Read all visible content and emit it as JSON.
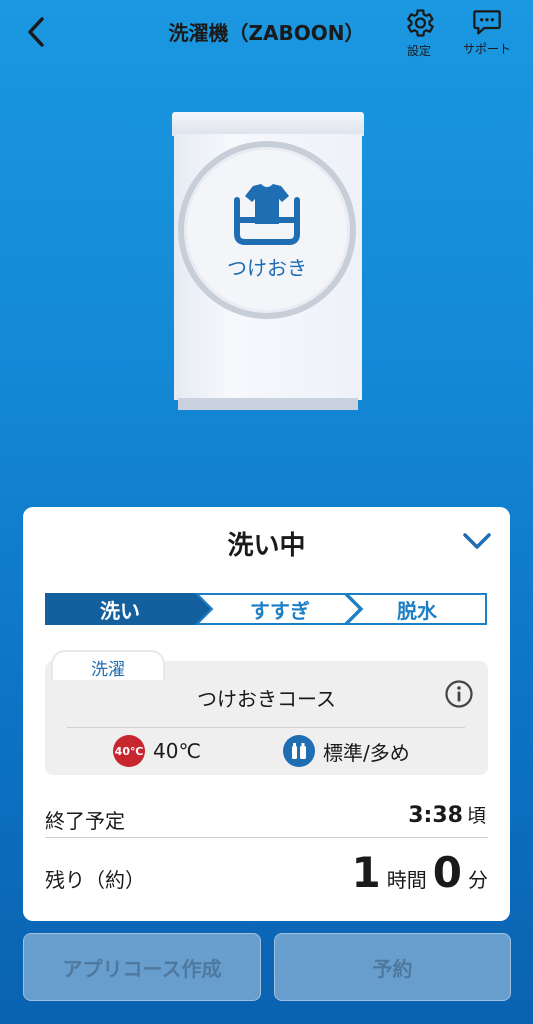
{
  "header": {
    "title": "洗濯機（ZABOON）",
    "settings_label": "設定",
    "support_label": "サポート"
  },
  "washer": {
    "course_label": "つけおき"
  },
  "status": {
    "title": "洗い中",
    "steps": [
      "洗い",
      "すすぎ",
      "脱水"
    ],
    "active_step": "洗い",
    "course_tab": "洗濯",
    "course_name": "つけおきコース",
    "temp_badge": "40℃",
    "temperature": "40℃",
    "detergent": "標準/多め",
    "end_label": "終了予定",
    "end_time": "3:38",
    "end_suffix": "頃",
    "remaining_label": "残り（約）",
    "remaining_hours": "1",
    "hours_unit": "時間",
    "remaining_minutes": "0",
    "minutes_unit": "分"
  },
  "buttons": {
    "create_course": "アプリコース作成",
    "reserve": "予約"
  },
  "colors": {
    "accent": "#1f6db3",
    "active_step": "#14609f",
    "temp_badge": "#c8262f"
  }
}
